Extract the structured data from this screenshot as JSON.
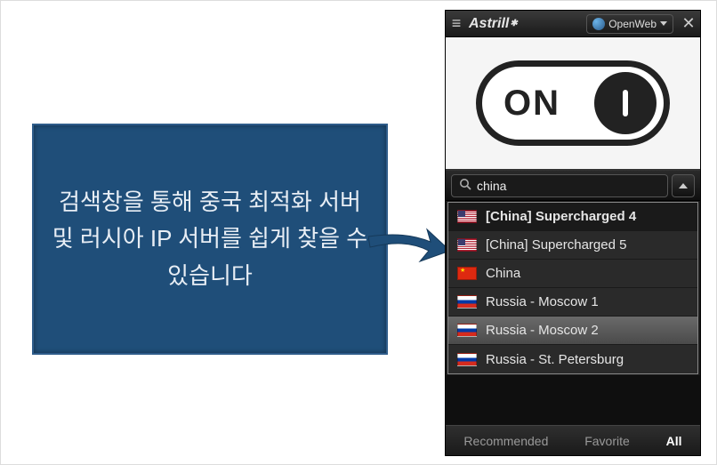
{
  "info": {
    "text": "검색창을 통해 중국 최적화 서버 및 러시아 IP 서버를 쉽게 찾을 수 있습니다"
  },
  "titlebar": {
    "app_name": "Astrill",
    "protocol": "OpenWeb"
  },
  "toggle": {
    "state_label": "ON"
  },
  "search": {
    "value": "china"
  },
  "servers": [
    {
      "flag": "us",
      "name": "[China] Supercharged 4",
      "bold": true,
      "state": "selected"
    },
    {
      "flag": "us",
      "name": "[China] Supercharged 5",
      "bold": false,
      "state": ""
    },
    {
      "flag": "cn",
      "name": "China",
      "bold": false,
      "state": ""
    },
    {
      "flag": "ru",
      "name": "Russia - Moscow 1",
      "bold": false,
      "state": ""
    },
    {
      "flag": "ru",
      "name": "Russia - Moscow 2",
      "bold": false,
      "state": "hovered"
    },
    {
      "flag": "ru",
      "name": "Russia - St. Petersburg",
      "bold": false,
      "state": ""
    }
  ],
  "tabs": {
    "recommended": "Recommended",
    "favorite": "Favorite",
    "all": "All",
    "active": "all"
  },
  "colors": {
    "info_bg": "#1f4e79",
    "arrow": "#1f4e79"
  }
}
